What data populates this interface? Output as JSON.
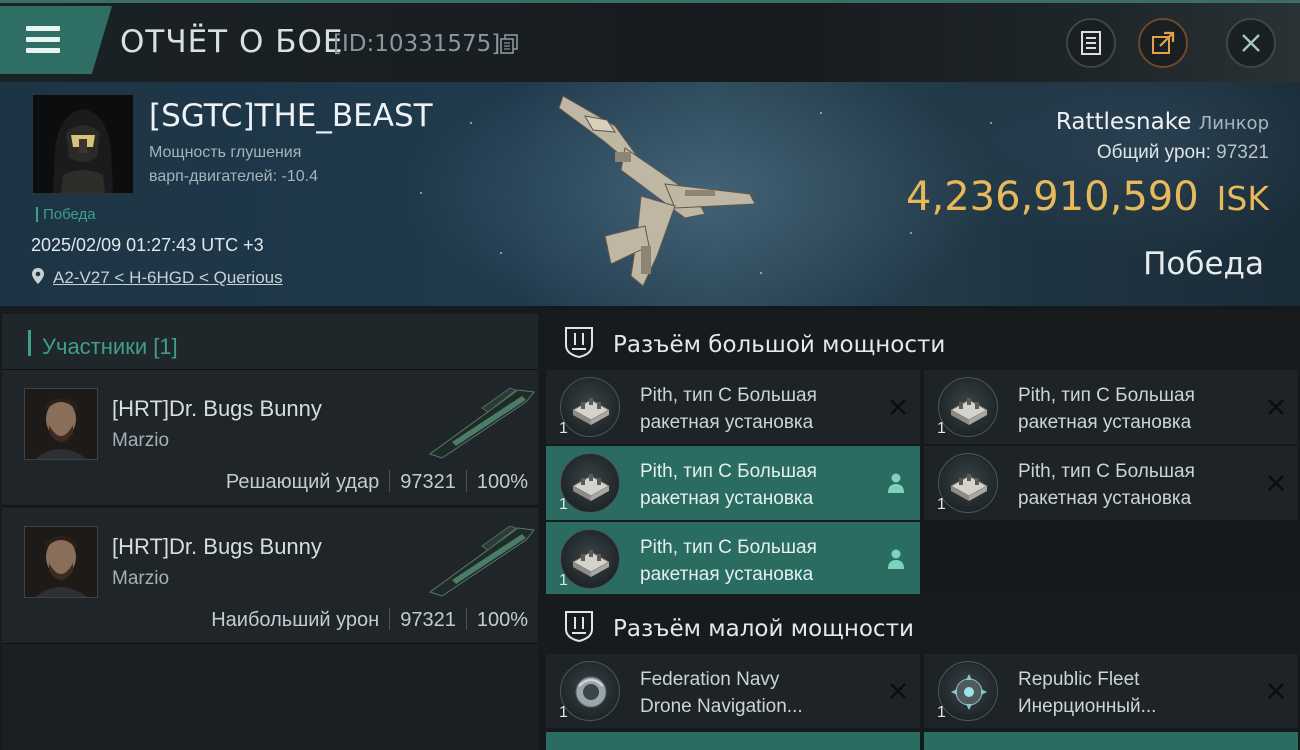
{
  "header": {
    "title": "ОТЧЁТ О БОЕ",
    "report_id": "[ID:10331575]"
  },
  "victim": {
    "name": "[SGTC]THE_BEAST",
    "effect_line1": "Мощность глушения",
    "effect_line2": "варп-двигателей: -10.4",
    "result_tag": "Победа",
    "datetime": "2025/02/09 01:27:43 UTC +3",
    "location": "A2-V27 < H-6HGD < Querious",
    "ship_name": "Rattlesnake",
    "ship_class": "Линкор",
    "total_damage_label": "Общий урон:",
    "total_damage": "97321",
    "isk_value": "4,236,910,590",
    "isk_unit": "ISK",
    "outcome": "Победа"
  },
  "participants_tab": {
    "label": "Участники [1]"
  },
  "participants": [
    {
      "name": "[HRT]Dr. Bugs Bunny",
      "ship": "Marzio",
      "role": "Решающий удар",
      "damage": "97321",
      "percent": "100%"
    },
    {
      "name": "[HRT]Dr. Bugs Bunny",
      "ship": "Marzio",
      "role": "Наибольший урон",
      "damage": "97321",
      "percent": "100%"
    }
  ],
  "sections": [
    {
      "title": "Разъём большой мощности",
      "modules": [
        {
          "qty": "1",
          "line1": "Pith, тип C Большая",
          "line2": "ракетная установка",
          "state": "destroyed"
        },
        {
          "qty": "1",
          "line1": "Pith, тип C Большая",
          "line2": "ракетная установка",
          "state": "destroyed"
        },
        {
          "qty": "1",
          "line1": "Pith, тип C Большая",
          "line2": "ракетная установка",
          "state": "dropped"
        },
        {
          "qty": "1",
          "line1": "Pith, тип C Большая",
          "line2": "ракетная установка",
          "state": "destroyed"
        },
        {
          "qty": "1",
          "line1": "Pith, тип C Большая",
          "line2": "ракетная установка",
          "state": "dropped"
        }
      ]
    },
    {
      "title": "Разъём малой мощности",
      "modules": [
        {
          "qty": "1",
          "line1": "Federation Navy",
          "line2": "Drone Navigation...",
          "state": "destroyed"
        },
        {
          "qty": "1",
          "line1": "Republic Fleet",
          "line2": "Инерционный...",
          "state": "destroyed"
        }
      ]
    }
  ],
  "colors": {
    "accent": "#3f9e8c",
    "active_slot": "#2b6c62",
    "isk": "#e8b95a"
  },
  "icons": {
    "menu": "hamburger-icon",
    "copy": "copy-icon",
    "notes": "document-icon",
    "share": "share-icon",
    "close": "close-icon",
    "location": "map-pin-icon",
    "slot_section": "shield-slot-icon",
    "destroyed": "x-icon",
    "dropped": "user-icon"
  }
}
